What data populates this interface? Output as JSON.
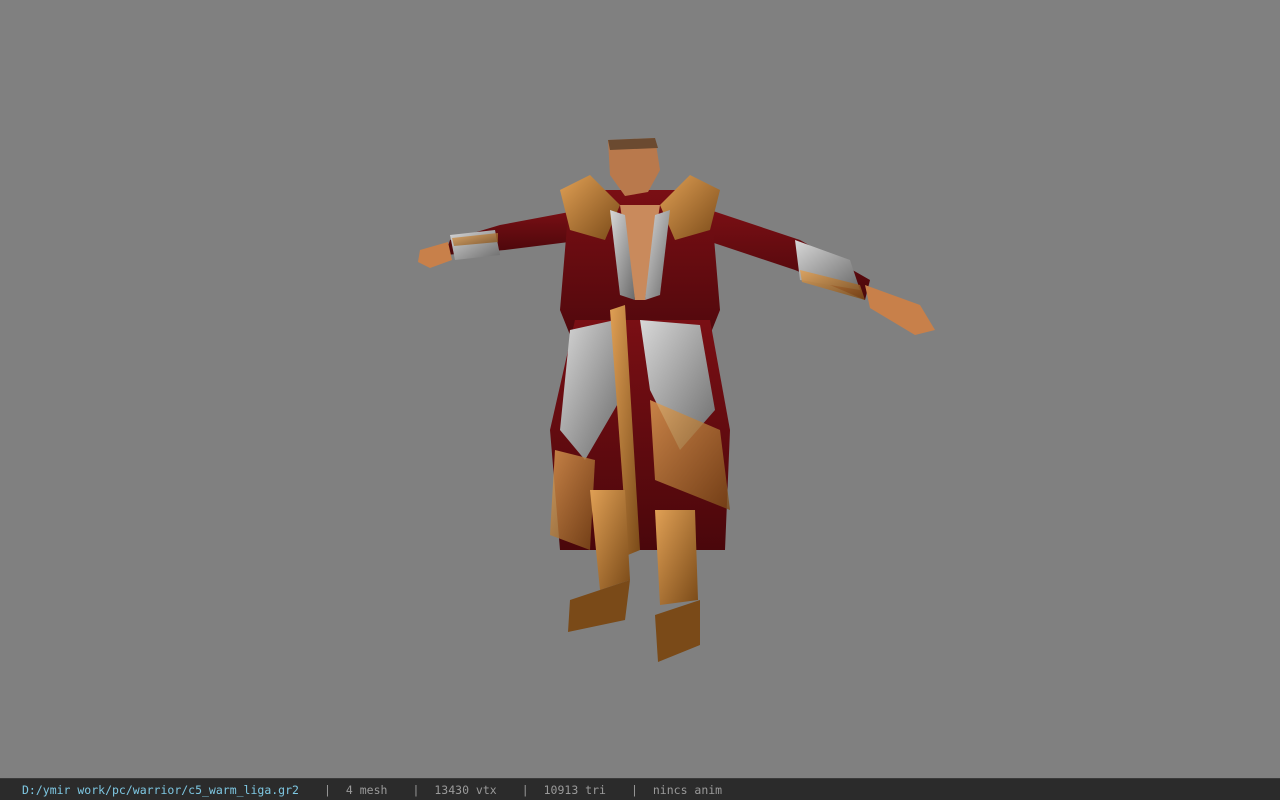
{
  "viewport": {
    "background": "#808080",
    "model_name": "warrior-character-model"
  },
  "status": {
    "file_path": "D:/ymir work/pc/warrior/c5_warm_liga.gr2",
    "separator": "|",
    "mesh": "4 mesh",
    "vertices": "13430 vtx",
    "triangles": "10913 tri",
    "animation": "nincs anim"
  },
  "colors": {
    "statusbar_bg": "#2b2b2b",
    "path_text": "#7ec8e3",
    "stat_text": "#9a9a9a"
  }
}
